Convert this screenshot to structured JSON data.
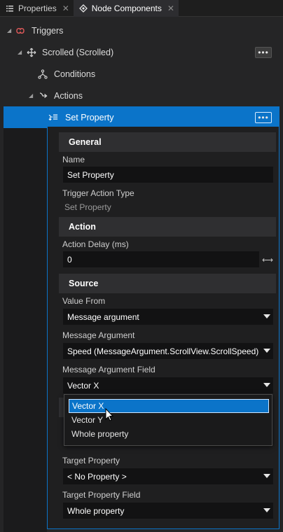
{
  "tabs": [
    {
      "label": "Properties",
      "icon": "list-icon",
      "close": "✕"
    },
    {
      "label": "Node Components",
      "icon": "component-icon",
      "close": "✕"
    }
  ],
  "tree": {
    "triggers": {
      "label": "Triggers",
      "icon": "trigger-icon"
    },
    "scrolled": {
      "label": "Scrolled (Scrolled)",
      "icon": "scroll-move-icon",
      "more": "•••"
    },
    "conditions": {
      "label": "Conditions",
      "icon": "hierarchy-icon"
    },
    "actions": {
      "label": "Actions",
      "icon": "action-arrow-icon"
    },
    "set_property": {
      "label": "Set Property",
      "icon": "set-property-icon",
      "more": "•••"
    }
  },
  "panel": {
    "general": {
      "title": "General",
      "name_label": "Name",
      "name_value": "Set Property",
      "type_label": "Trigger Action Type",
      "type_value": "Set Property"
    },
    "action": {
      "title": "Action",
      "delay_label": "Action Delay (ms)",
      "delay_value": "0",
      "spin_glyph": "⟷"
    },
    "source": {
      "title": "Source",
      "value_from_label": "Value From",
      "value_from_value": "Message argument",
      "msg_arg_label": "Message Argument",
      "msg_arg_value": "Speed (MessageArgument.ScrollView.ScrollSpeed)",
      "msg_field_label": "Message Argument Field",
      "msg_field_value": "Vector X",
      "target_prop_label": "Target Property",
      "target_prop_value": "< No Property >",
      "target_field_label": "Target Property Field",
      "target_field_value": "Whole property"
    }
  },
  "dropdown": {
    "options": [
      "Vector X",
      "Vector Y",
      "Whole property"
    ],
    "selected": "Vector X"
  },
  "colors": {
    "accent": "#0b74c9",
    "background": "#252526",
    "panel": "#1f1f20",
    "section": "#2f2f31",
    "input": "#121213"
  }
}
